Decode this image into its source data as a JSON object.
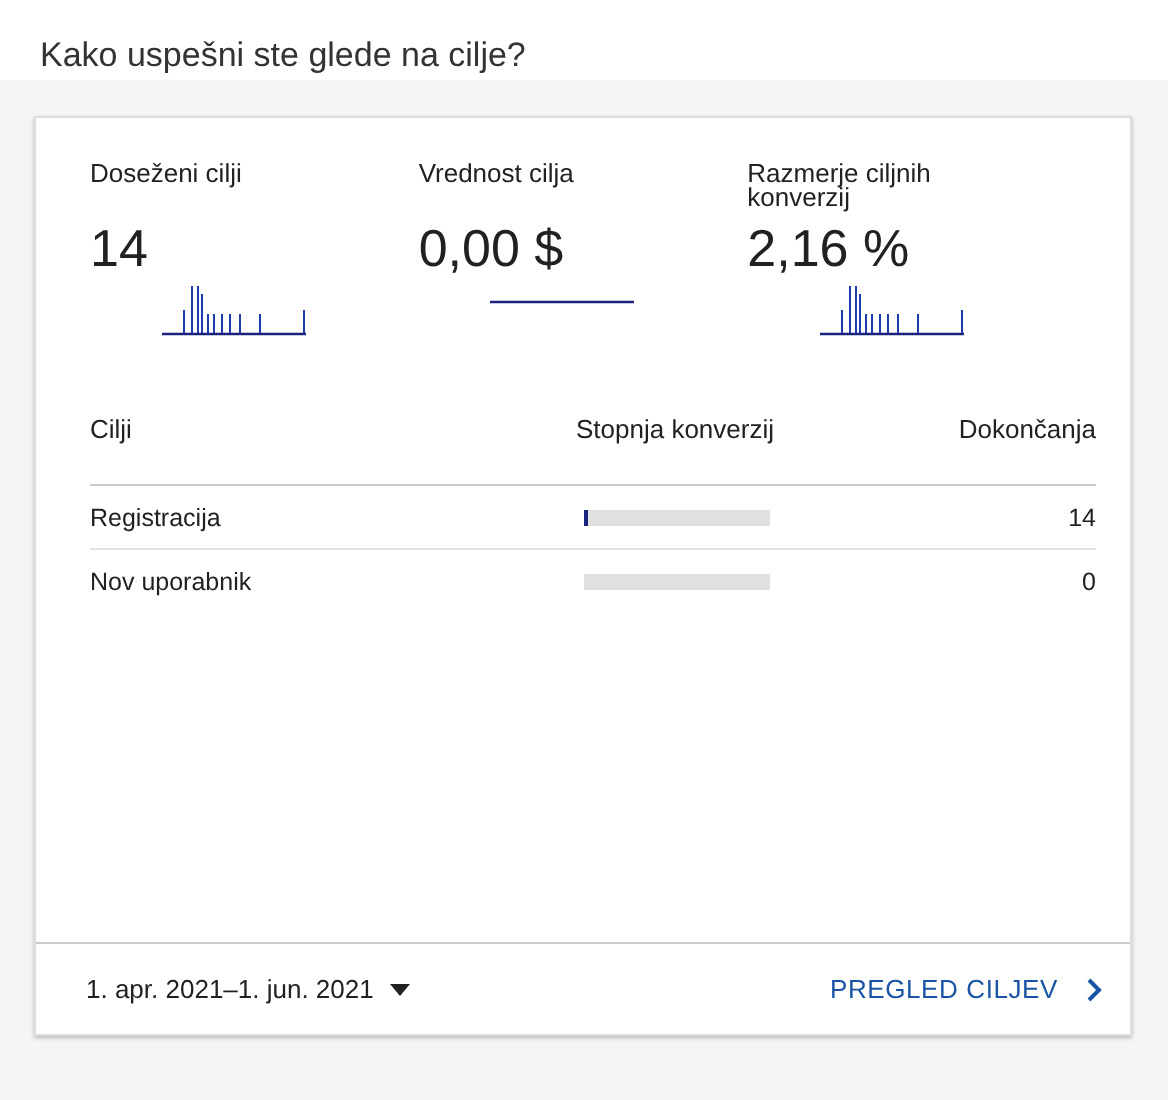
{
  "title": "Kako uspešni ste glede na cilje?",
  "metrics": [
    {
      "label": "Doseženi cilji",
      "value": "14",
      "kind": "spikes"
    },
    {
      "label": "Vrednost cilja",
      "value": "0,00 $",
      "kind": "flat"
    },
    {
      "label": "Razmerje ciljnih konverzij",
      "value": "2,16 %",
      "kind": "spikes"
    }
  ],
  "table": {
    "columns": [
      "Cilji",
      "Stopnja konverzij",
      "Dokončanja"
    ],
    "rows": [
      {
        "goal": "Registracija",
        "level": 0.02,
        "completions": "14"
      },
      {
        "goal": "Nov uporabnik",
        "level": 0,
        "completions": "0"
      }
    ]
  },
  "footer": {
    "date_range": "1. apr. 2021–1. jun. 2021",
    "link": "PREGLED CILJEV"
  }
}
